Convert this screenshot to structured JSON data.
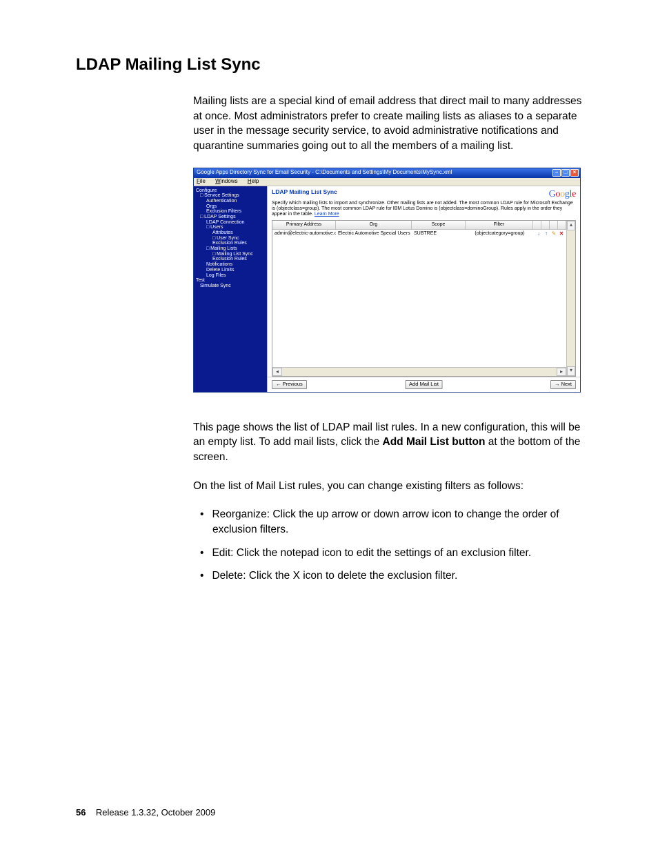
{
  "doc": {
    "heading": "LDAP Mailing List Sync",
    "para1": "Mailing lists are a special kind of email address that direct mail to many addresses at once. Most administrators prefer to create mailing lists as aliases to a separate user in the message security service, to avoid administrative notifications and quarantine summaries going out to all the members of a mailing list.",
    "para2_a": "This page shows the list of LDAP mail list rules. In a new configuration, this will be an empty list. To add mail lists, click the ",
    "para2_b": "Add Mail List button",
    "para2_c": " at the bottom of the screen.",
    "para3": "On the list of Mail List rules, you can change existing filters as follows:",
    "bullets": [
      "Reorganize: Click the up arrow or down arrow icon to change the order of exclusion filters.",
      "Edit: Click the notepad icon to edit the settings of an exclusion filter.",
      "Delete: Click the X icon to delete the exclusion filter."
    ],
    "footer_page": "56",
    "footer_text": "Release 1.3.32, October 2009"
  },
  "app": {
    "title": "Google Apps Directory Sync for Email Security - C:\\Documents and Settings\\My Documents\\MySync.xml",
    "menus": [
      "File",
      "Windows",
      "Help"
    ],
    "sidebar": [
      {
        "lvl": 0,
        "label": "Configure"
      },
      {
        "lvl": 1,
        "exp": "□",
        "label": "Service Settings"
      },
      {
        "lvl": 2,
        "label": "Authentication"
      },
      {
        "lvl": 2,
        "label": "Orgs"
      },
      {
        "lvl": 2,
        "label": "Exclusion Filters"
      },
      {
        "lvl": 1,
        "exp": "□",
        "label": "LDAP Settings"
      },
      {
        "lvl": 2,
        "label": "LDAP Connection"
      },
      {
        "lvl": 2,
        "exp": "□",
        "label": "Users"
      },
      {
        "lvl": 3,
        "label": "Attributes"
      },
      {
        "lvl": 3,
        "exp": "□",
        "label": "User Sync"
      },
      {
        "lvl": 3,
        "label": "Exclusion Rules"
      },
      {
        "lvl": 2,
        "exp": "□",
        "label": "Mailing Lists"
      },
      {
        "lvl": 3,
        "exp": "□",
        "label": "Mailing List Sync"
      },
      {
        "lvl": 3,
        "label": "Exclusion Rules"
      },
      {
        "lvl": 2,
        "label": "Notifications"
      },
      {
        "lvl": 2,
        "label": "Delete Limits"
      },
      {
        "lvl": 2,
        "label": "Log Files"
      },
      {
        "lvl": 0,
        "label": "Test"
      },
      {
        "lvl": 1,
        "label": "Simulate Sync"
      }
    ],
    "content_title": "LDAP Mailing List Sync",
    "content_desc": "Specify which mailing lists to import and synchronize. Other mailing lists are not added. The most common LDAP rule for Microsoft Exchange is (objectclass=group). The most common LDAP rule for IBM Lotus Domino is (objectclass=dominoGroup). Rules apply in the order they appear in the table. ",
    "learn_more": "Learn More",
    "columns": {
      "primary": "Primary Address",
      "org": "Org",
      "scope": "Scope",
      "filter": "Filter"
    },
    "row": {
      "primary": "admin@electric-automotive.com",
      "org": "Electric Automotive Special Users",
      "scope": "SUBTREE",
      "filter": "(objectcategory=group)"
    },
    "buttons": {
      "previous": "← Previous",
      "addmail": "Add Mail List",
      "next": "→ Next"
    }
  }
}
